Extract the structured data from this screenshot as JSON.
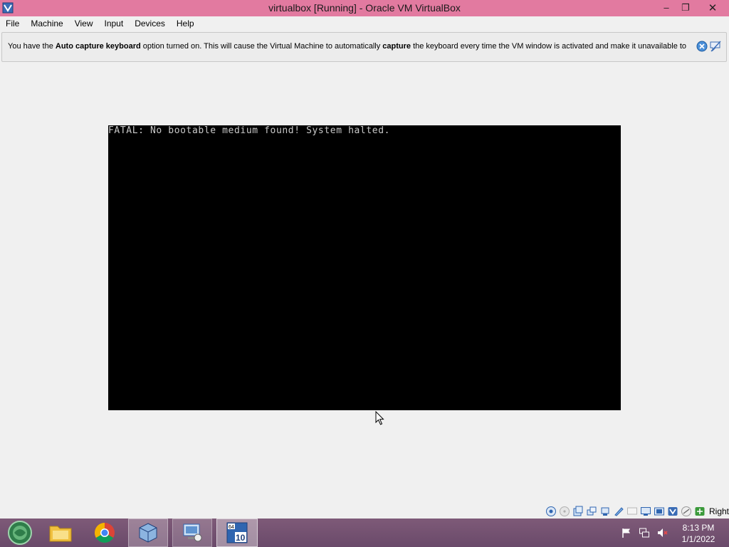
{
  "window": {
    "title": "virtualbox [Running] - Oracle VM VirtualBox",
    "icon": "virtualbox-app-icon",
    "controls": {
      "minimize": "–",
      "restore": "❐",
      "close": "✕"
    },
    "title_bar_color": "#e27aa0"
  },
  "menu": {
    "items": [
      "File",
      "Machine",
      "View",
      "Input",
      "Devices",
      "Help"
    ]
  },
  "banner": {
    "text_1": "You have the ",
    "bold_1": "Auto capture keyboard",
    "text_2": " option turned on. This will cause the Virtual Machine to automatically ",
    "bold_2": "capture",
    "text_3": " the keyboard every time the VM window is activated and make it unavailable to"
  },
  "vm": {
    "screen_text": "FATAL: No bootable medium found! System halted."
  },
  "statusbar": {
    "icons": [
      "hard-disk-icon",
      "optical-drive-icon",
      "audio-icon",
      "network-icon",
      "usb-icon",
      "shared-folder-icon",
      "display-icon",
      "video-capture-icon",
      "virtualization-icon",
      "mouse-integration-icon",
      "keyboard-icon"
    ],
    "host_key": "Right Ctrl"
  },
  "taskbar": {
    "apps": [
      "start-button",
      "file-explorer",
      "google-chrome",
      "virtualbox-manager",
      "network-app",
      "virtualbox-vm-windows-10"
    ],
    "tray_icons": [
      "action-center-flag-icon",
      "network-tray-icon",
      "volume-muted-icon"
    ],
    "time": "8:13 PM",
    "date": "1/1/2022",
    "color": "#7a5674"
  }
}
